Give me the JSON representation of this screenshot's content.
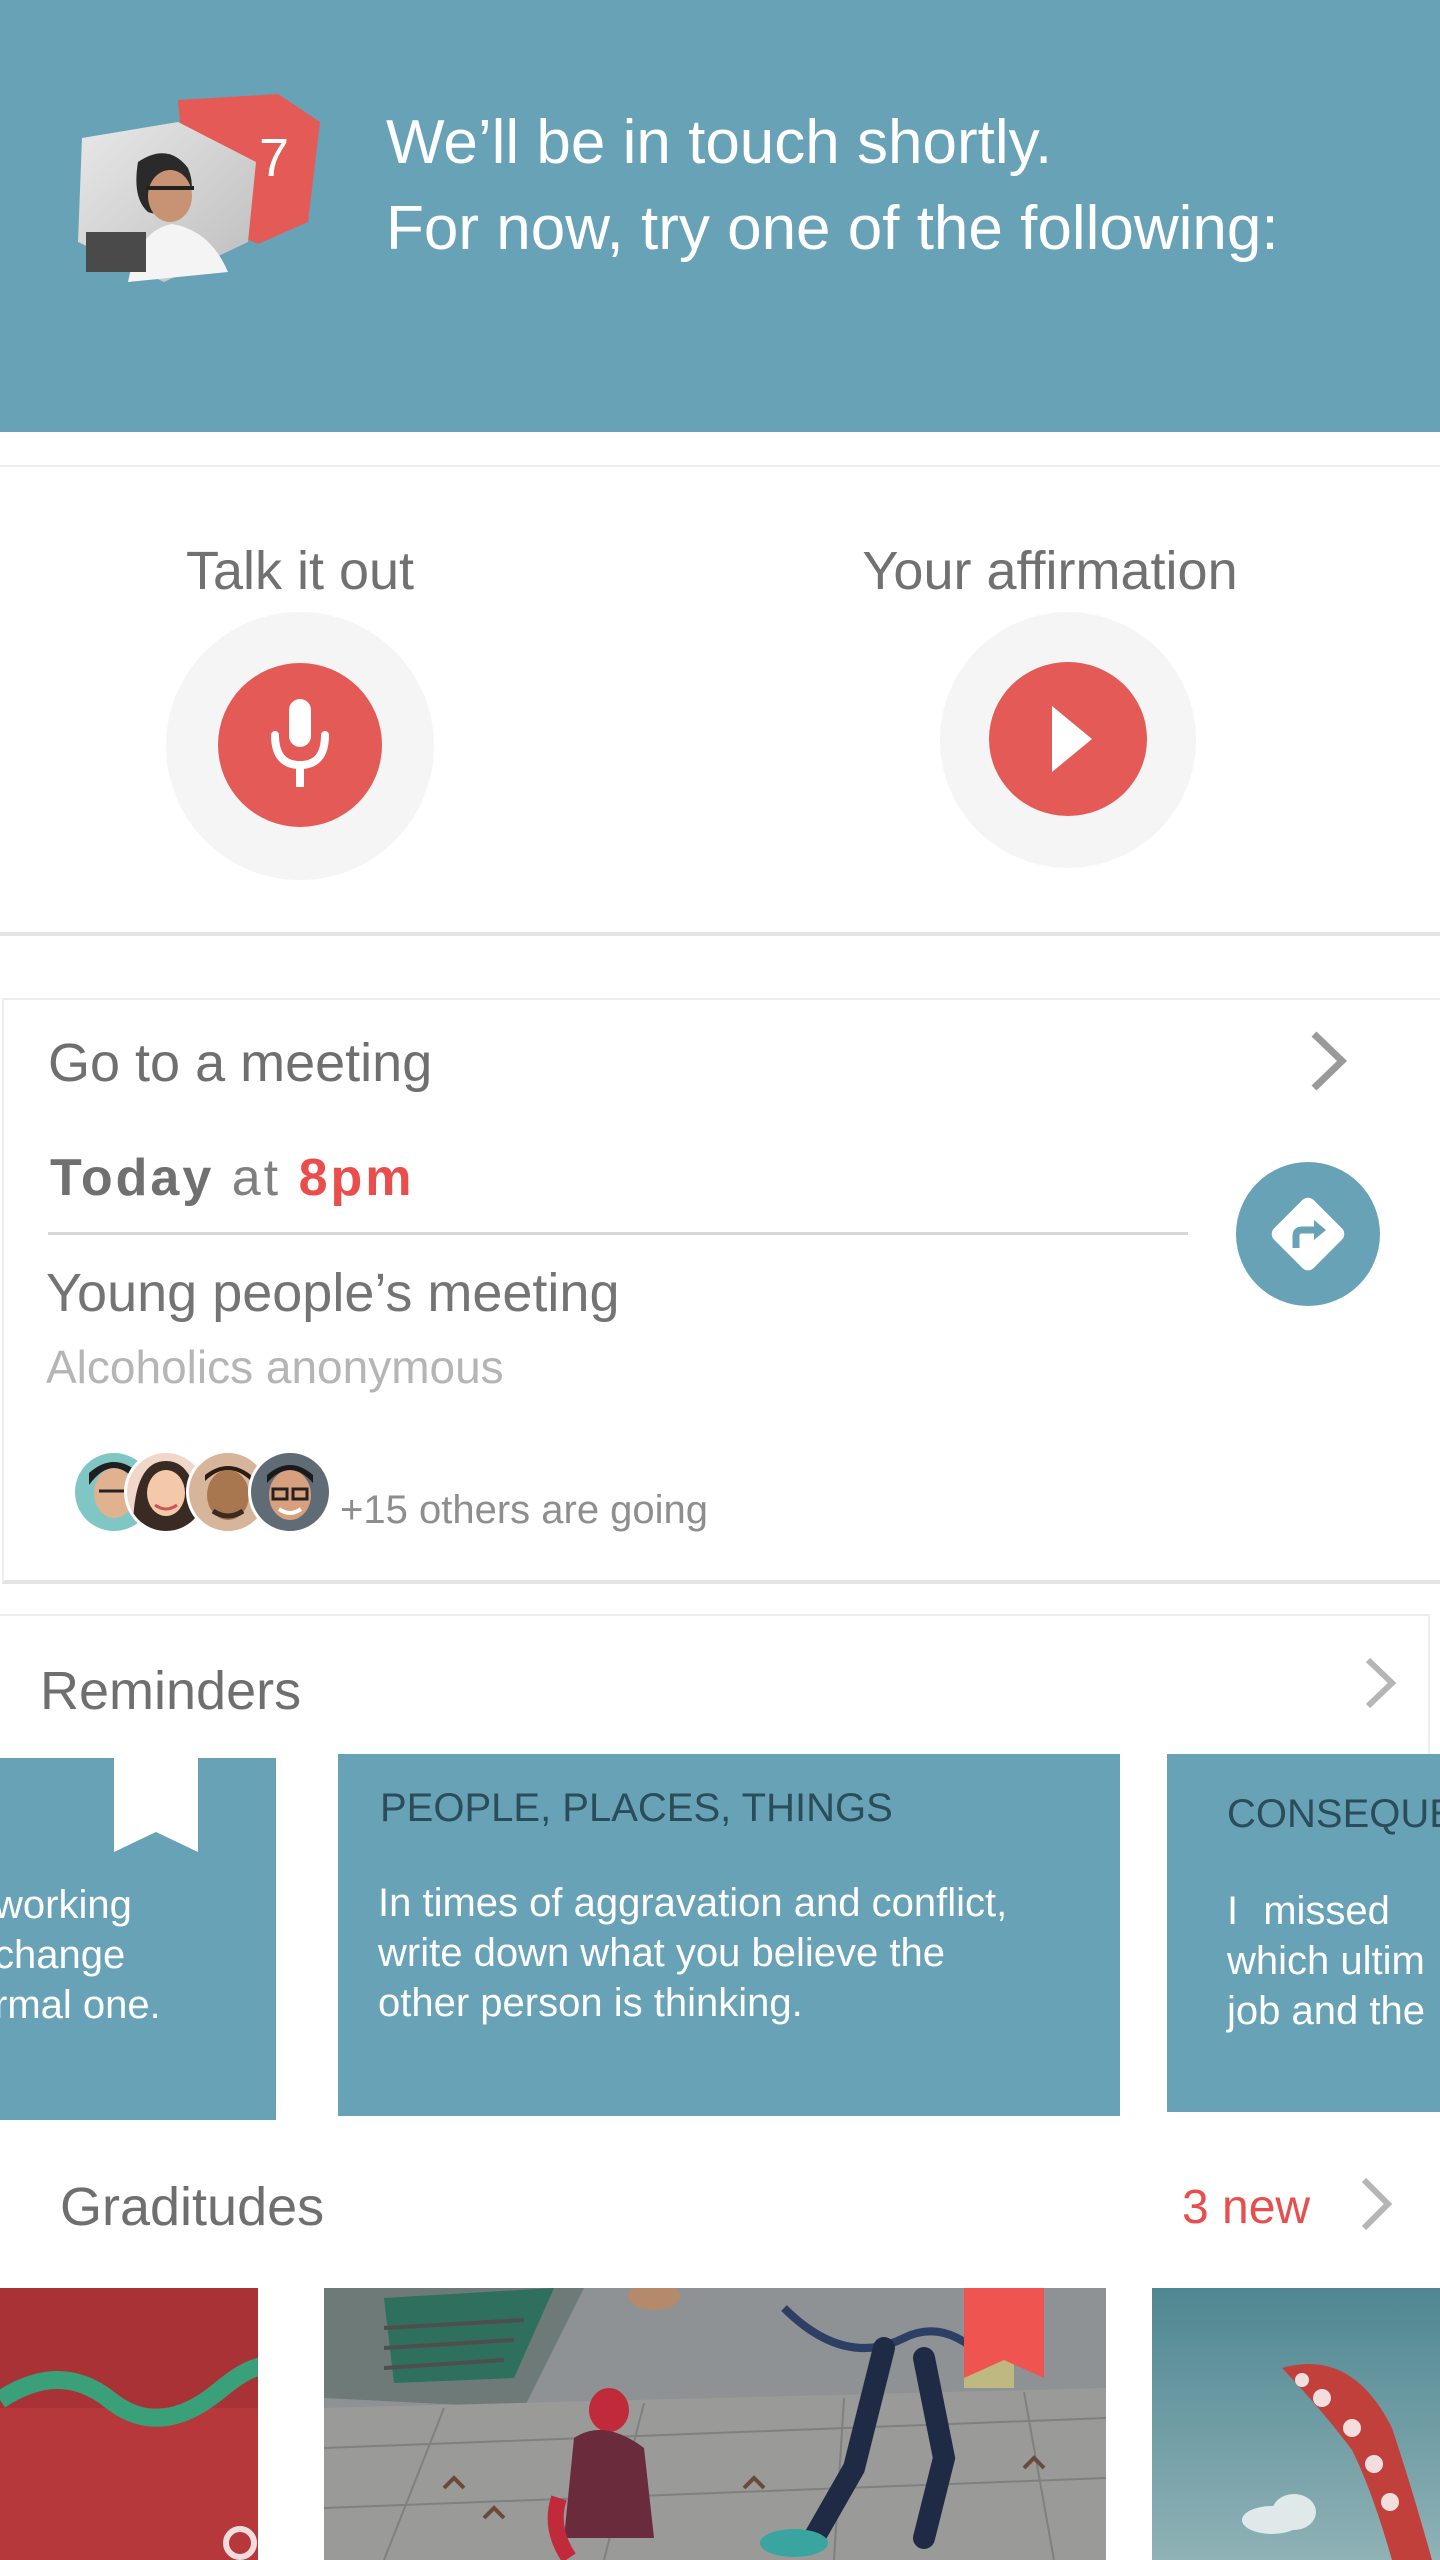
{
  "header": {
    "badge_count": "7",
    "line1": "We’ll be in touch shortly.",
    "line2": "For now, try one of the following:",
    "background_color": "#68a2b7"
  },
  "quick_actions": {
    "talk_label": "Talk it out",
    "talk_icon": "microphone-icon",
    "affirmation_label": "Your affirmation",
    "affirmation_icon": "play-icon",
    "accent_color": "#e45a57"
  },
  "meeting": {
    "title": "Go to a meeting",
    "day": "Today",
    "at": "at",
    "time": "8pm",
    "name": "Young people’s meeting",
    "organization": "Alcoholics anonymous",
    "attendees_text": "+15 others are going",
    "directions_icon": "directions-icon"
  },
  "reminders": {
    "title": "Reminders",
    "cards": [
      {
        "heading": "",
        "lines": [
          "working",
          "change",
          "rmal one."
        ]
      },
      {
        "heading": "PEOPLE, PLACES, THINGS",
        "lines": [
          "In times of aggravation and conflict,",
          "write down what you believe the",
          "other person is thinking."
        ]
      },
      {
        "heading": "CONSEQUE",
        "lines": [
          "I missed",
          "which ultim",
          "job and the"
        ]
      }
    ]
  },
  "graditudes": {
    "title": "Graditudes",
    "new_count": "3 new"
  }
}
